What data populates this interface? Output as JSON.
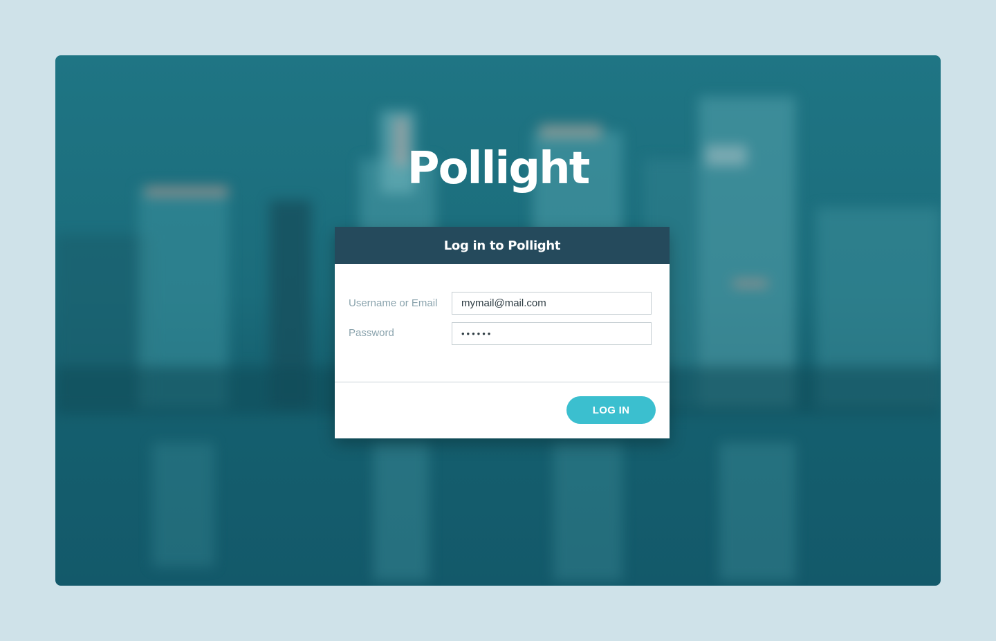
{
  "brand": {
    "logo_text": "Pollight"
  },
  "login_card": {
    "title": "Log in to Pollight",
    "username_label": "Username or Email",
    "username_value": "mymail@mail.com",
    "password_label": "Password",
    "password_value": "••••••",
    "submit_label": "LOG IN"
  },
  "colors": {
    "page_background": "#cfe2e9",
    "scene_tint": "#1f7584",
    "header": "#254a5c",
    "button": "#3bbfcf"
  }
}
